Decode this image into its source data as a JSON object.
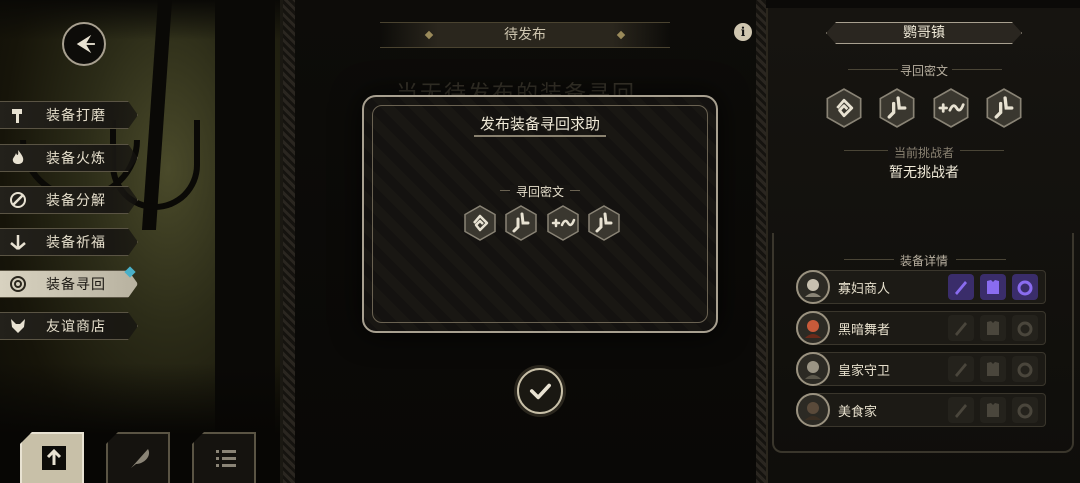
{
  "pending": {
    "header": "待发布",
    "ghost_text": "当无待发布的装备寻回"
  },
  "modal": {
    "title": "发布装备寻回求助",
    "subtitle": "寻回密文",
    "runes": [
      "spiral-rune",
      "boot-rune",
      "cross-wave-rune",
      "boot-rune"
    ]
  },
  "menu": {
    "items": [
      {
        "label": "装备打磨",
        "icon": "hammer-icon"
      },
      {
        "label": "装备火炼",
        "icon": "flame-icon"
      },
      {
        "label": "装备分解",
        "icon": "split-icon"
      },
      {
        "label": "装备祈福",
        "icon": "pray-icon"
      },
      {
        "label": "装备寻回",
        "icon": "target-icon",
        "active": true
      },
      {
        "label": "友谊商店",
        "icon": "fox-icon"
      }
    ],
    "tabs": [
      "upload-icon",
      "feather-icon",
      "list-icon"
    ]
  },
  "right_panel": {
    "town": "鹦哥镇",
    "cipher_heading": "寻回密文",
    "challenger_label": "当前挑战者",
    "challenger_value": "暂无挑战者",
    "detail_heading": "装备详情",
    "characters": [
      {
        "name": "寡妇商人",
        "slots_active": true
      },
      {
        "name": "黑暗舞者",
        "slots_active": false
      },
      {
        "name": "皇家守卫",
        "slots_active": false
      },
      {
        "name": "美食家",
        "slots_active": false
      }
    ]
  },
  "colors": {
    "accent_purple": "#6b4fc8",
    "frame": "#a8a090",
    "badge": "#4ab0c8"
  }
}
